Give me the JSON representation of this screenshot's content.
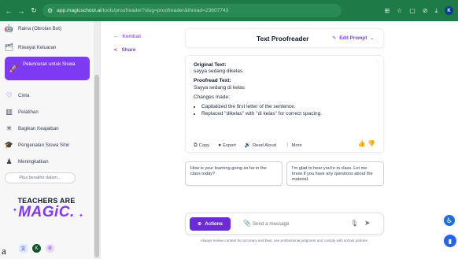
{
  "browser": {
    "url_host": "app.magicschool.ai",
    "url_path": "/tools/proofreader?slug=proofreader&thread=23607743"
  },
  "sidebar": {
    "items": [
      {
        "label": "Raina (Obrolan Bot)",
        "icon": "robot-icon"
      },
      {
        "label": "Riwayat Keluaran",
        "icon": "history-icon"
      },
      {
        "label": "Peluncuran untuk Siswa",
        "icon": "rocket-icon",
        "active": true
      },
      {
        "label": "Cinta",
        "icon": "heart-icon"
      },
      {
        "label": "Pelatihan",
        "icon": "training-icon"
      },
      {
        "label": "Bagikan Keajaiban",
        "icon": "share-magic-icon"
      },
      {
        "label": "Pengenalan Siswa Sihir",
        "icon": "student-icon"
      },
      {
        "label": "Meningkatkan",
        "icon": "upgrade-icon"
      }
    ],
    "search_placeholder": "Plus berakhir dalam...",
    "brand_line1": "TEACHERS ARE",
    "brand_line2": "MAGiC."
  },
  "main": {
    "back_label": "Kembali",
    "share_label": "Share",
    "tool_title": "Text Proofreader",
    "edit_prompt_label": "Edit Prompt",
    "response": {
      "original_heading": "Original Text:",
      "original_text": "sayya sedang dikelas",
      "proofread_heading": "Proofread Text:",
      "proofread_text": "Sayya sedang di kelas",
      "changes_heading": "Changes made:",
      "changes": [
        "Capitalized the first letter of the sentence.",
        "Replaced \"dikelas\" with \"di kelas\" for correct spacing."
      ],
      "actions": {
        "copy": "Copy",
        "export": "Export",
        "read_aloud": "Read Aloud",
        "more": "More"
      }
    },
    "suggestions": [
      "How is your learning going so far in the class today?",
      "I'm glad to hear you're in class. Let me know if you have any questions about the material."
    ],
    "input": {
      "actions_label": "Actions",
      "placeholder": "Send a message"
    },
    "disclaimer": "Always review content for accuracy and bias; use professional judgment and comply with school policies."
  },
  "stray_char": "a"
}
